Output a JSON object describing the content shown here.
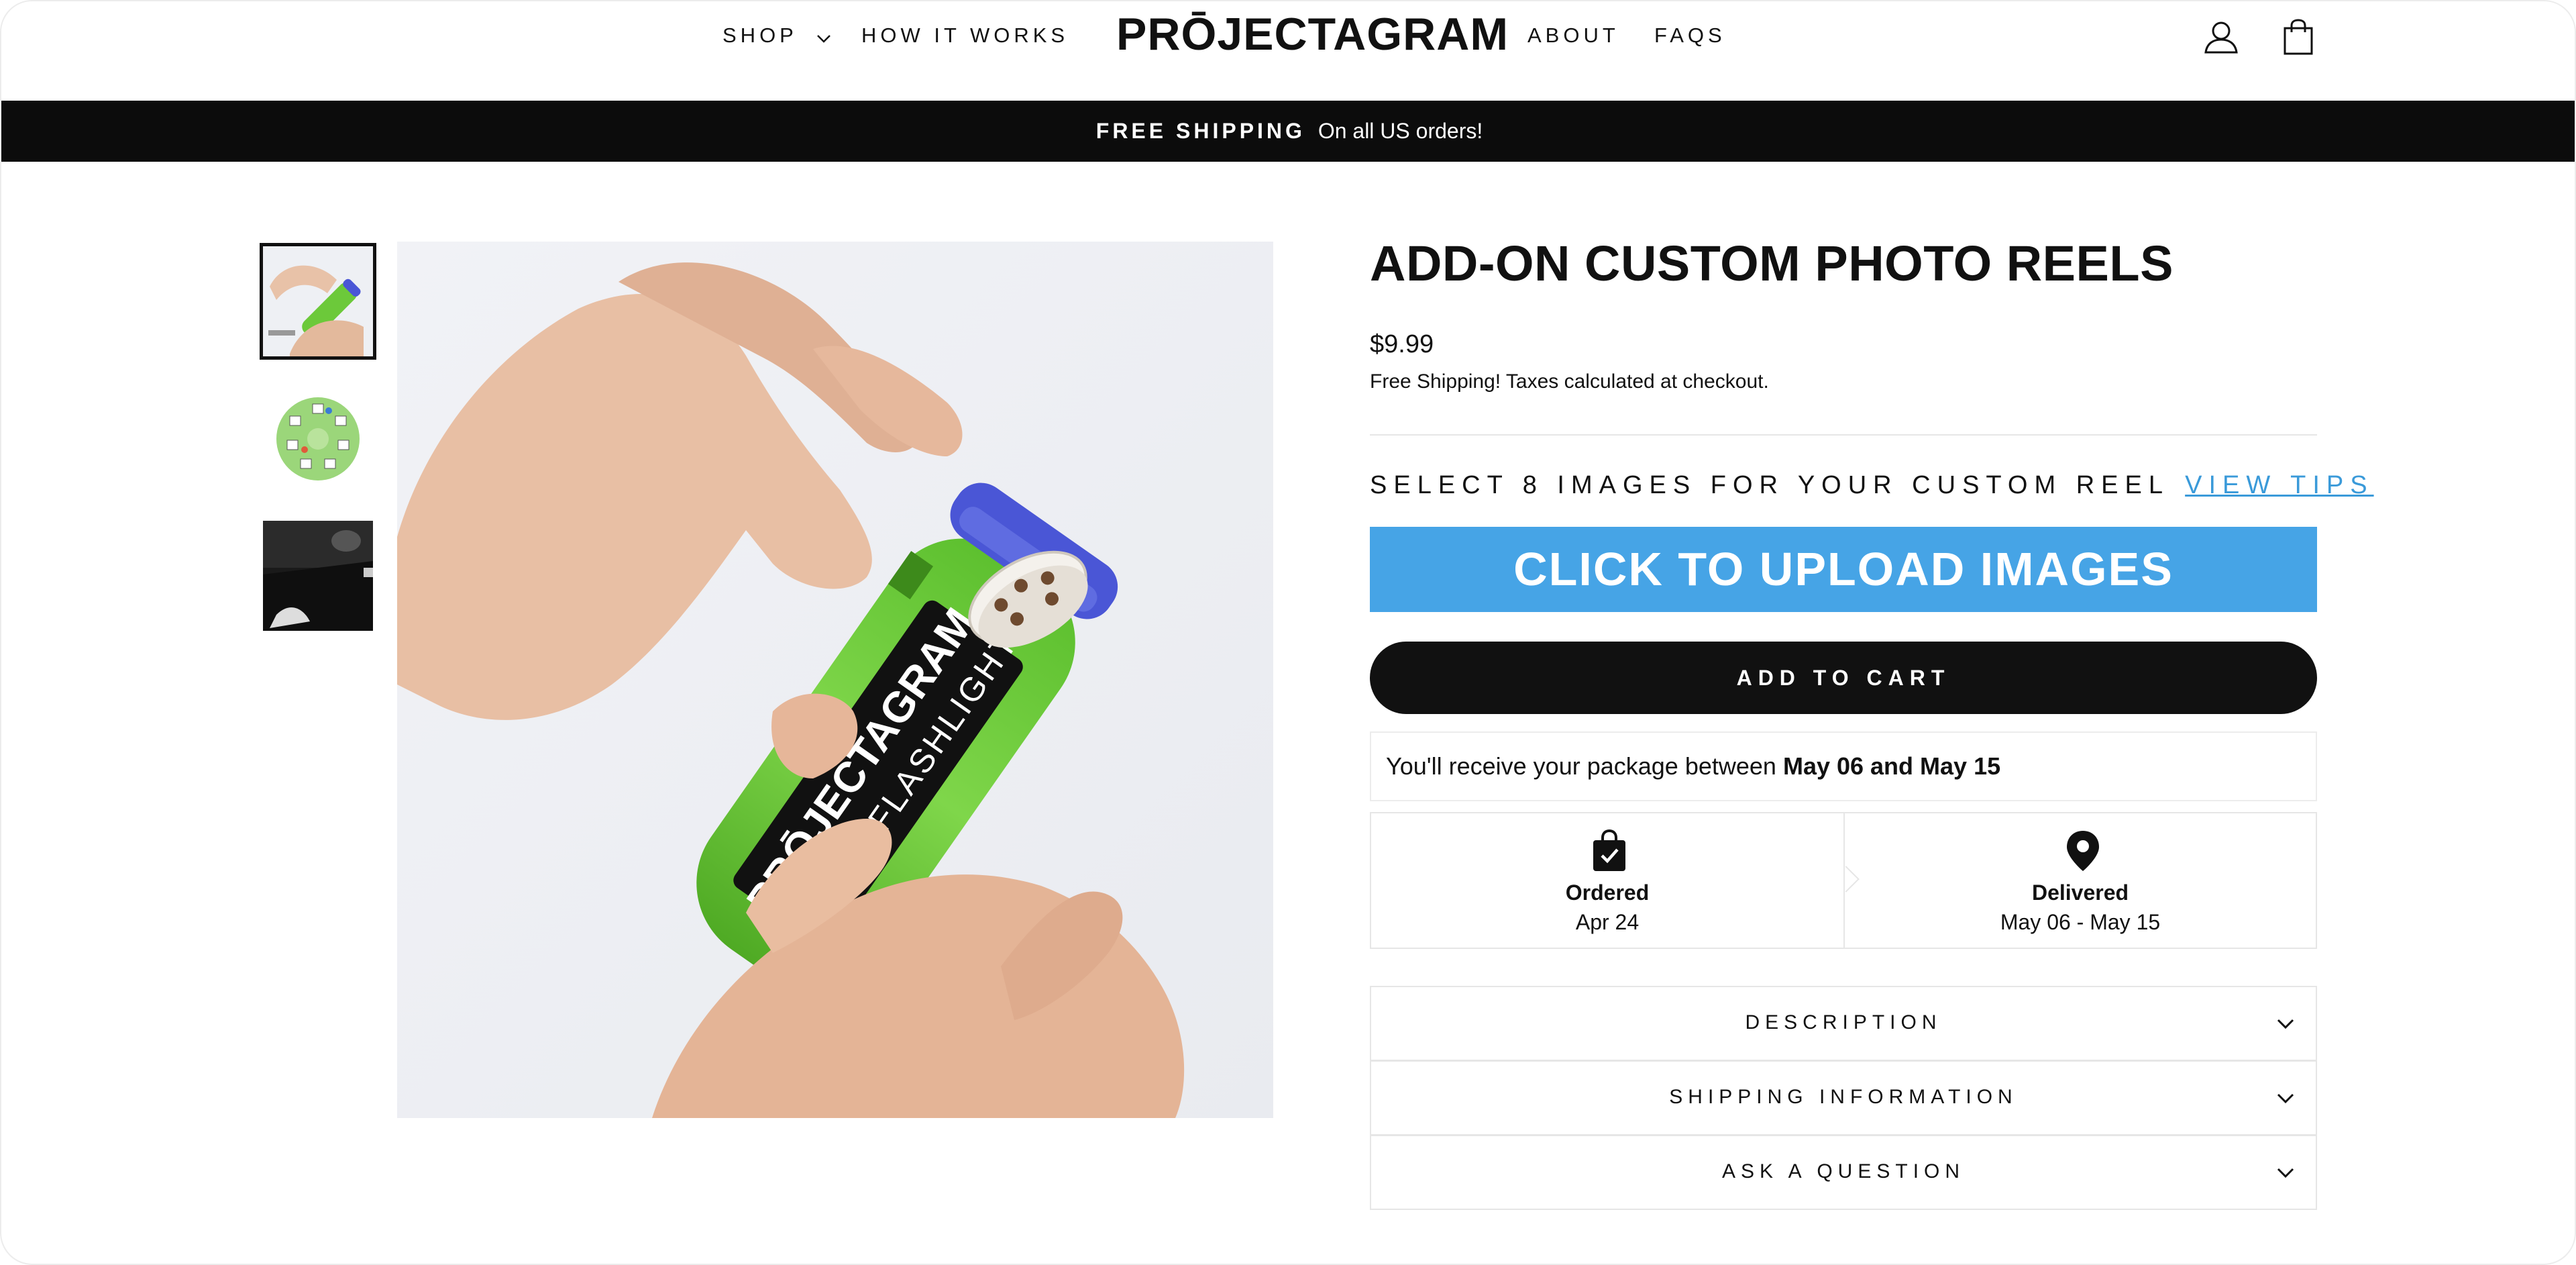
{
  "header": {
    "nav_left": [
      {
        "label": "SHOP"
      },
      {
        "label": "HOW IT WORKS"
      }
    ],
    "logo": "PRŌJECTAGRAM",
    "nav_right": [
      {
        "label": "ABOUT"
      },
      {
        "label": "FAQS"
      }
    ],
    "icons": [
      "account-icon",
      "cart-icon"
    ]
  },
  "announcement": {
    "bold": "FREE SHIPPING",
    "text": "On all US orders!"
  },
  "gallery": {
    "thumbnails": [
      {
        "name": "hand-holding-flashlight",
        "active": true
      },
      {
        "name": "photo-reel-disc",
        "active": false
      },
      {
        "name": "projection-on-wall",
        "active": false
      }
    ],
    "main_image_text": {
      "brand": "PRŌJECTAGRAM",
      "sub": "PHOTO FLASHLIGHT"
    }
  },
  "product": {
    "title": "ADD-ON CUSTOM PHOTO REELS",
    "price": "$9.99",
    "price_note": "Free Shipping! Taxes calculated at checkout.",
    "select_label": "SELECT 8 IMAGES FOR YOUR CUSTOM REEL",
    "view_tips": "VIEW TIPS",
    "upload_button": "CLICK TO UPLOAD IMAGES",
    "add_to_cart": "ADD TO CART",
    "delivery_prefix": "You'll receive your package between",
    "delivery_range": "May 06 and May 15",
    "timeline": [
      {
        "label": "Ordered",
        "date": "Apr 24",
        "icon": "shopping-bag-check-icon"
      },
      {
        "label": "Delivered",
        "date": "May 06 - May 15",
        "icon": "map-pin-icon"
      }
    ],
    "accordions": [
      {
        "label": "DESCRIPTION"
      },
      {
        "label": "SHIPPING INFORMATION"
      },
      {
        "label": "ASK A QUESTION"
      }
    ]
  },
  "colors": {
    "upload_button": "#46a4e6",
    "link": "#3a9ad9",
    "announcement_bg": "#0c0c0c",
    "flashlight_green": "#6cc93a",
    "flashlight_cap": "#4a56d6"
  }
}
